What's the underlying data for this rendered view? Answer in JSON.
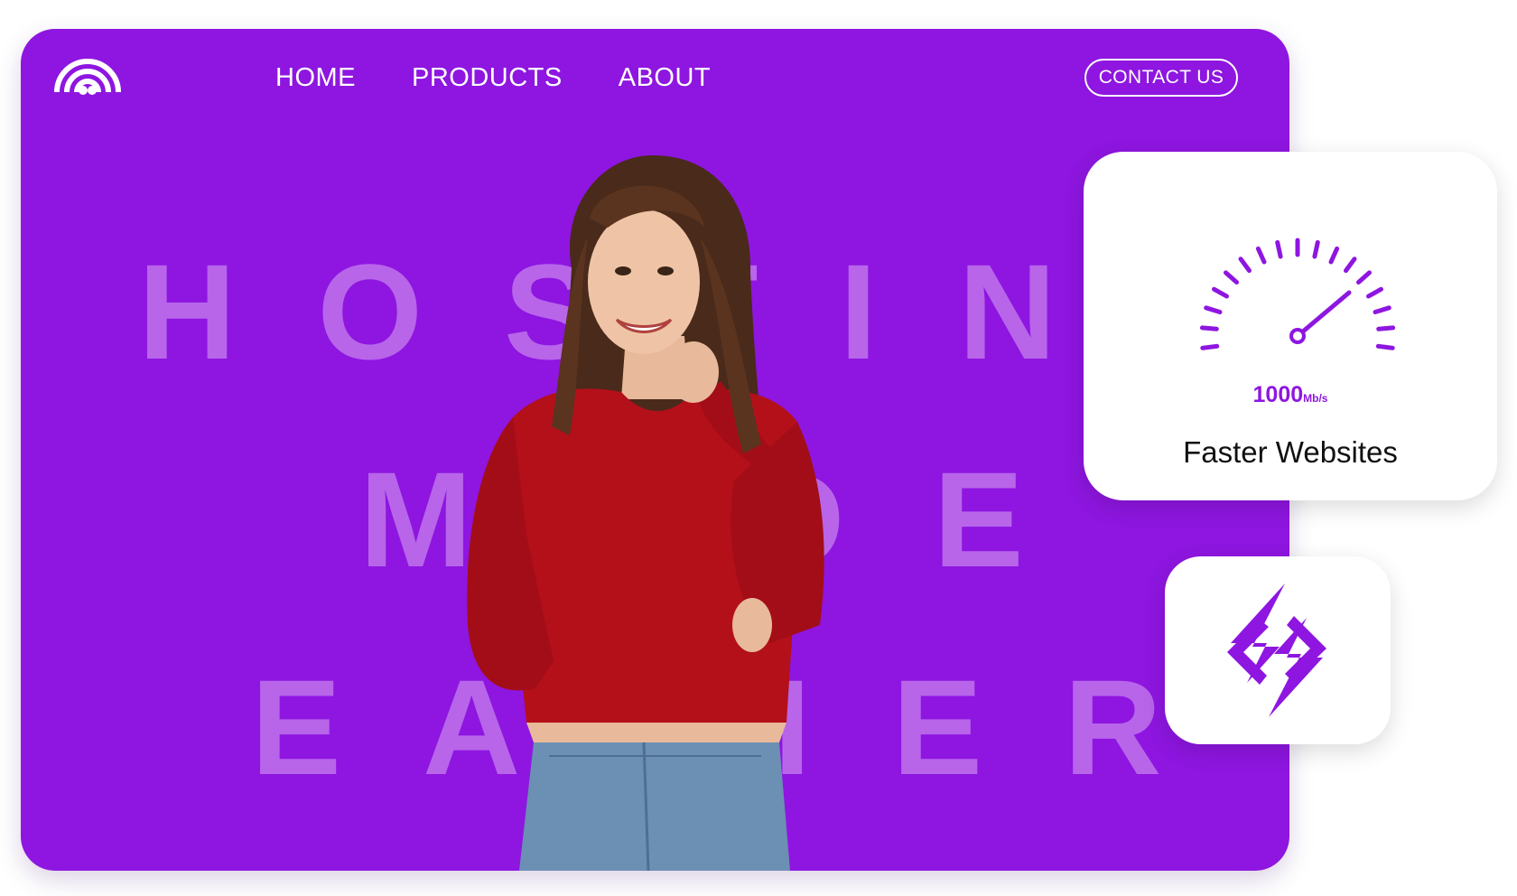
{
  "header": {
    "logo_icon": "rainbow-signal-logo-icon",
    "nav": [
      {
        "label": "HOME"
      },
      {
        "label": "PRODUCTS"
      },
      {
        "label": "ABOUT"
      }
    ],
    "contact_label": "CONTACT US"
  },
  "hero": {
    "background_text_lines": [
      "HOSTING",
      "MADE",
      "EASIER"
    ],
    "background_color": "#8e16e0",
    "background_text_color": "#b865ea",
    "image": "smiling-woman-red-sweater-photo"
  },
  "speed_card": {
    "icon": "speedometer-icon",
    "value": "1000",
    "unit": "Mb/s",
    "title": "Faster Websites"
  },
  "app_icon_card": {
    "icon": "lightning-bolt-logo-icon"
  },
  "colors": {
    "accent": "#8e16e0",
    "card": "#ffffff"
  }
}
